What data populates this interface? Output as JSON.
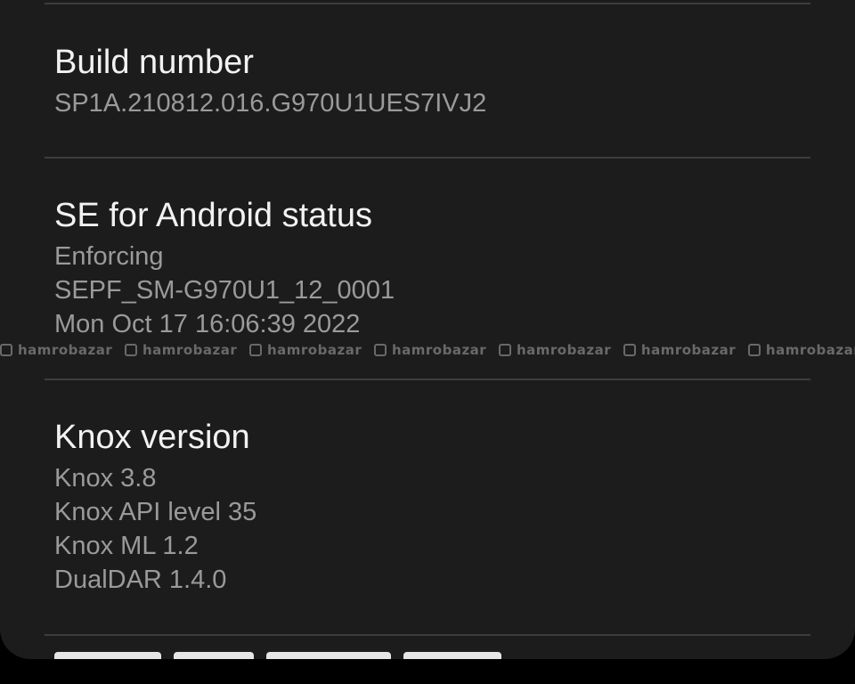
{
  "items": [
    {
      "title": "Build number",
      "lines": [
        "SP1A.210812.016.G970U1UES7IVJ2"
      ]
    },
    {
      "title": "SE for Android status",
      "lines": [
        "Enforcing",
        "SEPF_SM-G970U1_12_0001",
        "Mon Oct 17 16:06:39 2022"
      ]
    },
    {
      "title": "Knox version",
      "lines": [
        "Knox 3.8",
        "Knox API level 35",
        "Knox ML 1.2",
        "DualDAR 1.4.0"
      ]
    }
  ],
  "watermark": {
    "text": "hamrobazar"
  },
  "colors": {
    "background": "#000000",
    "card": "#1c1c1c",
    "title": "#f2f2f2",
    "subtitle": "#9a9a9a",
    "divider": "#3d3d3d"
  }
}
